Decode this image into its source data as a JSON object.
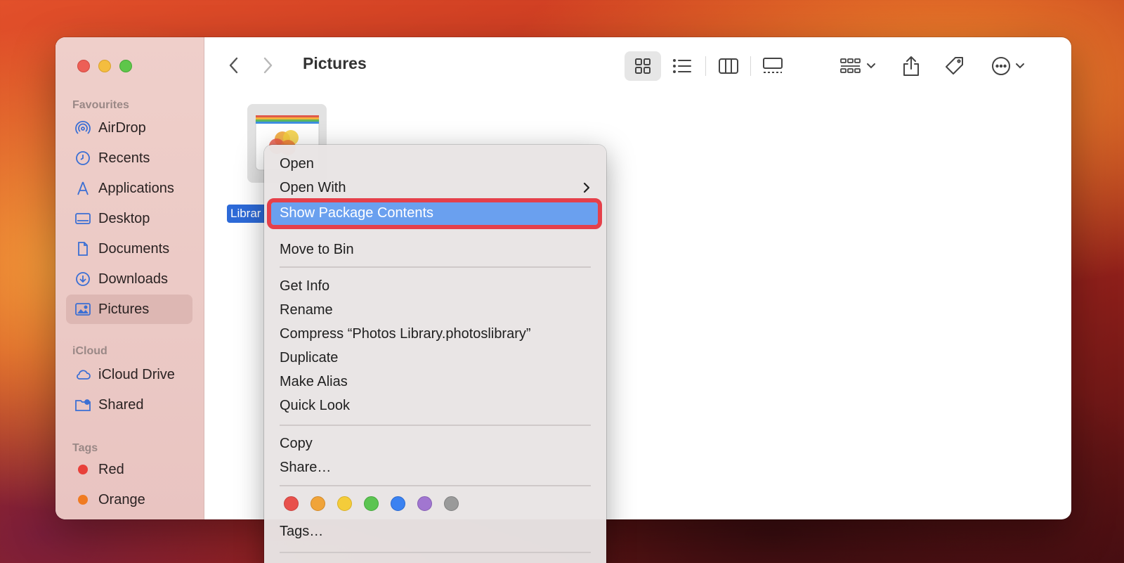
{
  "window": {
    "title": "Pictures"
  },
  "sidebar": {
    "sections": {
      "favourites": "Favourites",
      "icloud": "iCloud",
      "tags": "Tags"
    },
    "favourites": [
      {
        "label": "AirDrop",
        "icon": "airdrop-icon"
      },
      {
        "label": "Recents",
        "icon": "clock-icon"
      },
      {
        "label": "Applications",
        "icon": "applications-icon"
      },
      {
        "label": "Desktop",
        "icon": "desktop-icon"
      },
      {
        "label": "Documents",
        "icon": "document-icon"
      },
      {
        "label": "Downloads",
        "icon": "download-icon"
      },
      {
        "label": "Pictures",
        "icon": "photo-icon"
      }
    ],
    "icloud": [
      {
        "label": "iCloud Drive",
        "icon": "cloud-icon"
      },
      {
        "label": "Shared",
        "icon": "shared-folder-icon"
      }
    ],
    "tags": [
      {
        "label": "Red",
        "color": "#e8403a"
      },
      {
        "label": "Orange",
        "color": "#f07b21"
      }
    ]
  },
  "file": {
    "label": "Librar"
  },
  "context_menu": {
    "items": {
      "open": "Open",
      "open_with": "Open With",
      "show_package_contents": "Show Package Contents",
      "move_to_bin": "Move to Bin",
      "get_info": "Get Info",
      "rename": "Rename",
      "compress": "Compress “Photos Library.photoslibrary”",
      "duplicate": "Duplicate",
      "make_alias": "Make Alias",
      "quick_look": "Quick Look",
      "copy": "Copy",
      "share": "Share…",
      "tags": "Tags…"
    },
    "tag_colors": [
      "#e8514c",
      "#f0a43a",
      "#f4cc3a",
      "#5cc452",
      "#3b82f1",
      "#a176d0",
      "#9a9a9a"
    ]
  }
}
